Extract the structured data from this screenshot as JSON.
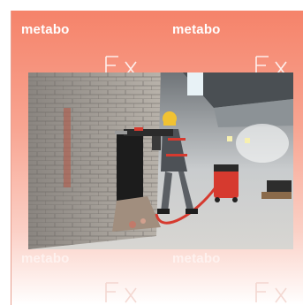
{
  "brand": {
    "name": "metabo",
    "accent": "#f5836a"
  },
  "icons": {
    "watermark": "f-x-watermark-icon"
  },
  "photo": {
    "subject": "worker-with-demolition-hammer-and-dust-extractor"
  }
}
